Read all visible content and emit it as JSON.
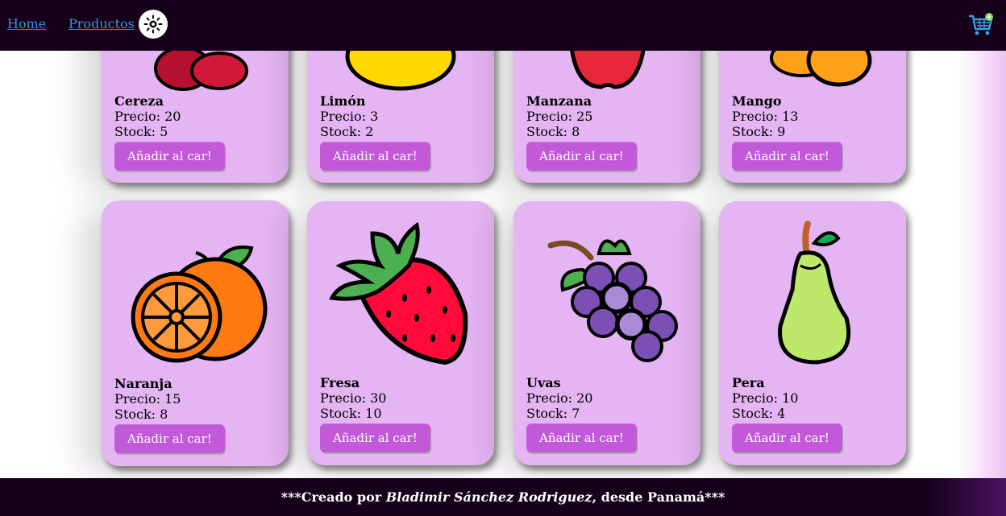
{
  "nav": {
    "home_label": "Home",
    "products_label": "Productos",
    "theme_icon": "sun-icon",
    "cart_icon": "cart-plus-icon"
  },
  "products": [
    {
      "name": "Cereza",
      "price": "Precio: 20",
      "stock": "Stock: 5",
      "button": "Añadir al car!"
    },
    {
      "name": "Limón",
      "price": "Precio: 3",
      "stock": "Stock: 2",
      "button": "Añadir al car!"
    },
    {
      "name": "Manzana",
      "price": "Precio: 25",
      "stock": "Stock: 8",
      "button": "Añadir al car!"
    },
    {
      "name": "Mango",
      "price": "Precio: 13",
      "stock": "Stock: 9",
      "button": "Añadir al car!"
    },
    {
      "name": "Naranja",
      "price": "Precio: 15",
      "stock": "Stock: 8",
      "button": "Añadir al car!"
    },
    {
      "name": "Fresa",
      "price": "Precio: 30",
      "stock": "Stock: 10",
      "button": "Añadir al car!"
    },
    {
      "name": "Uvas",
      "price": "Precio: 20",
      "stock": "Stock: 7",
      "button": "Añadir al car!"
    },
    {
      "name": "Pera",
      "price": "Precio: 10",
      "stock": "Stock: 4",
      "button": "Añadir al car!"
    }
  ],
  "footer": {
    "prefix": "***Creado por ",
    "author": "Bladimir Sánchez Rodriguez",
    "suffix": ", desde Panamá***"
  },
  "colors": {
    "navbar": "#16001a",
    "card": "#e5b4f3",
    "button": "#c159d9",
    "link": "#3d8fe0"
  }
}
